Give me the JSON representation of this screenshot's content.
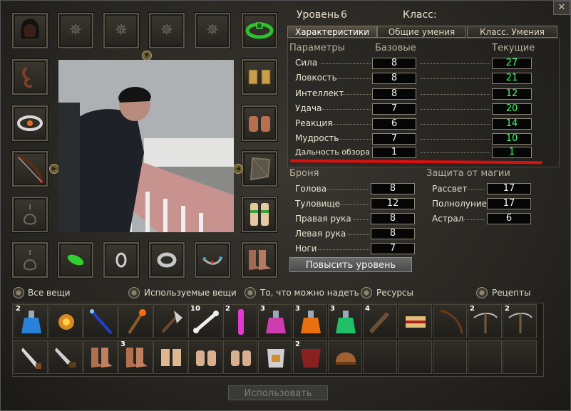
{
  "header": {
    "level_label": "Уровень",
    "level_value": "6",
    "class_label": "Класс:",
    "class_value": ""
  },
  "window": {
    "close_symbol": "✕"
  },
  "tabs": [
    {
      "label": "Характеристики",
      "active": true
    },
    {
      "label": "Общие умения",
      "active": false
    },
    {
      "label": "Класс. Умения",
      "active": false
    }
  ],
  "params": {
    "header": "Параметры",
    "base_header": "Базовые",
    "current_header": "Текущие",
    "rows": [
      {
        "name": "Сила",
        "base": "8",
        "current": "27"
      },
      {
        "name": "Ловкость",
        "base": "8",
        "current": "21"
      },
      {
        "name": "Интеллект",
        "base": "8",
        "current": "12"
      },
      {
        "name": "Удача",
        "base": "7",
        "current": "20"
      },
      {
        "name": "Реакция",
        "base": "6",
        "current": "14"
      },
      {
        "name": "Мудрость",
        "base": "7",
        "current": "10"
      },
      {
        "name": "Дальность обзора",
        "base": "1",
        "current": "1"
      }
    ]
  },
  "armor": {
    "header": "Броня",
    "rows": [
      {
        "name": "Голова",
        "value": "8"
      },
      {
        "name": "Туловище",
        "value": "12"
      },
      {
        "name": "Правая рука",
        "value": "8"
      },
      {
        "name": "Левая рука",
        "value": "8"
      },
      {
        "name": "Ноги",
        "value": "7"
      }
    ]
  },
  "magic": {
    "header": "Защита от магии",
    "rows": [
      {
        "name": "Рассвет",
        "value": "17"
      },
      {
        "name": "Полнолуние",
        "value": "17"
      },
      {
        "name": "Астрал",
        "value": "6"
      }
    ]
  },
  "level_up_button": "Повысить уровень",
  "filters": [
    {
      "label": "Все вещи",
      "selected": true
    },
    {
      "label": "Используемые вещи",
      "selected": false
    },
    {
      "label": "То, что можно надеть",
      "selected": false
    },
    {
      "label": "Ресурсы",
      "selected": false
    },
    {
      "label": "Рецепты",
      "selected": false
    }
  ],
  "inventory": {
    "row1": [
      {
        "item": "blue-potion-icon",
        "count": "2"
      },
      {
        "item": "amulet-icon",
        "count": ""
      },
      {
        "item": "staff-icon",
        "count": ""
      },
      {
        "item": "fire-staff-icon",
        "count": ""
      },
      {
        "item": "axe-icon",
        "count": ""
      },
      {
        "item": "bone-icon",
        "count": "10"
      },
      {
        "item": "pink-vial-icon",
        "count": "2"
      },
      {
        "item": "pink-potion-icon",
        "count": "3"
      },
      {
        "item": "orange-potion-icon",
        "count": "3"
      },
      {
        "item": "green-potion-icon",
        "count": "3"
      },
      {
        "item": "club-icon",
        "count": "4"
      },
      {
        "item": "scroll-pack-icon",
        "count": ""
      },
      {
        "item": "bow-icon",
        "count": ""
      },
      {
        "item": "crossbow-icon",
        "count": "2"
      },
      {
        "item": "crossbow-icon",
        "count": "2"
      }
    ],
    "row2": [
      {
        "item": "dagger-icon",
        "count": ""
      },
      {
        "item": "knife-icon",
        "count": ""
      },
      {
        "item": "boots-icon",
        "count": ""
      },
      {
        "item": "boots-icon",
        "count": "3"
      },
      {
        "item": "bracers-icon",
        "count": ""
      },
      {
        "item": "gloves-icon",
        "count": ""
      },
      {
        "item": "gloves-icon",
        "count": ""
      },
      {
        "item": "armor-icon",
        "count": ""
      },
      {
        "item": "red-armor-icon",
        "count": "2"
      },
      {
        "item": "helmet-icon",
        "count": ""
      },
      {
        "item": "",
        "count": ""
      },
      {
        "item": "",
        "count": ""
      },
      {
        "item": "",
        "count": ""
      },
      {
        "item": "",
        "count": ""
      },
      {
        "item": "",
        "count": ""
      }
    ]
  },
  "use_button": "Использовать",
  "colors": {
    "current_value": "#39ff6b",
    "highlight_line": "#e10d0d"
  }
}
